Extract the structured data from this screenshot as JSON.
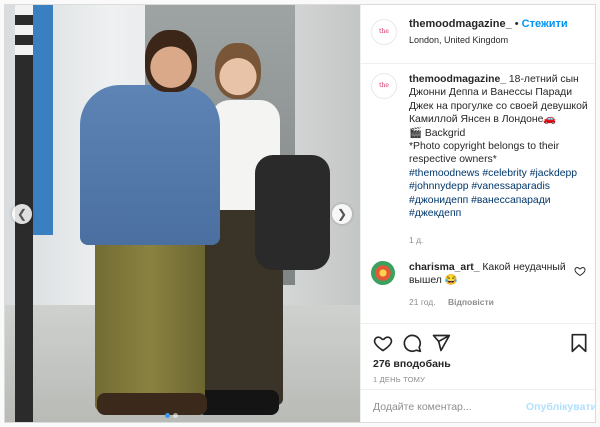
{
  "post": {
    "username": "themoodmagazine_",
    "separator": "•",
    "follow_label": "Стежити",
    "location": "London, United Kingdom",
    "avatar_text": "the mood",
    "caption": {
      "username": "themoodmagazine_",
      "text": "18-летний сын Джонни Деппа и Ванессы Паради Джек на прогулке со своей девушкой Камиллой Янсен в Лондоне🚗\n🎬 Backgrid\n*Photo copyright belongs to their respective owners*",
      "hashtags": "#themoodnews #celebrity #jackdepp #johnnydepp #vanessaparadis #джонидепп #ванессапаради #джекдепп",
      "time": "1 д."
    },
    "comment": {
      "username": "charisma_art_",
      "text": "Какой неудачный вышел 😂",
      "time": "21 год.",
      "reply_label": "Відповісти"
    },
    "likes": "276 вподобань",
    "time_ago": "1 ДЕНЬ ТОМУ",
    "add_comment_placeholder": "Додайте коментар...",
    "publish_label": "Опублікувати"
  },
  "carousel": {
    "current": 1,
    "total": 2
  },
  "icons": [
    "heart-icon",
    "comment-icon",
    "share-icon",
    "bookmark-icon",
    "chevron-left-icon",
    "chevron-right-icon",
    "comment-heart-icon"
  ],
  "colors": {
    "link": "#0095f6",
    "hashtag": "#00376b",
    "muted": "#8e8e8e",
    "publish_disabled": "#b2dffc",
    "dot_active": "#3897f0"
  }
}
